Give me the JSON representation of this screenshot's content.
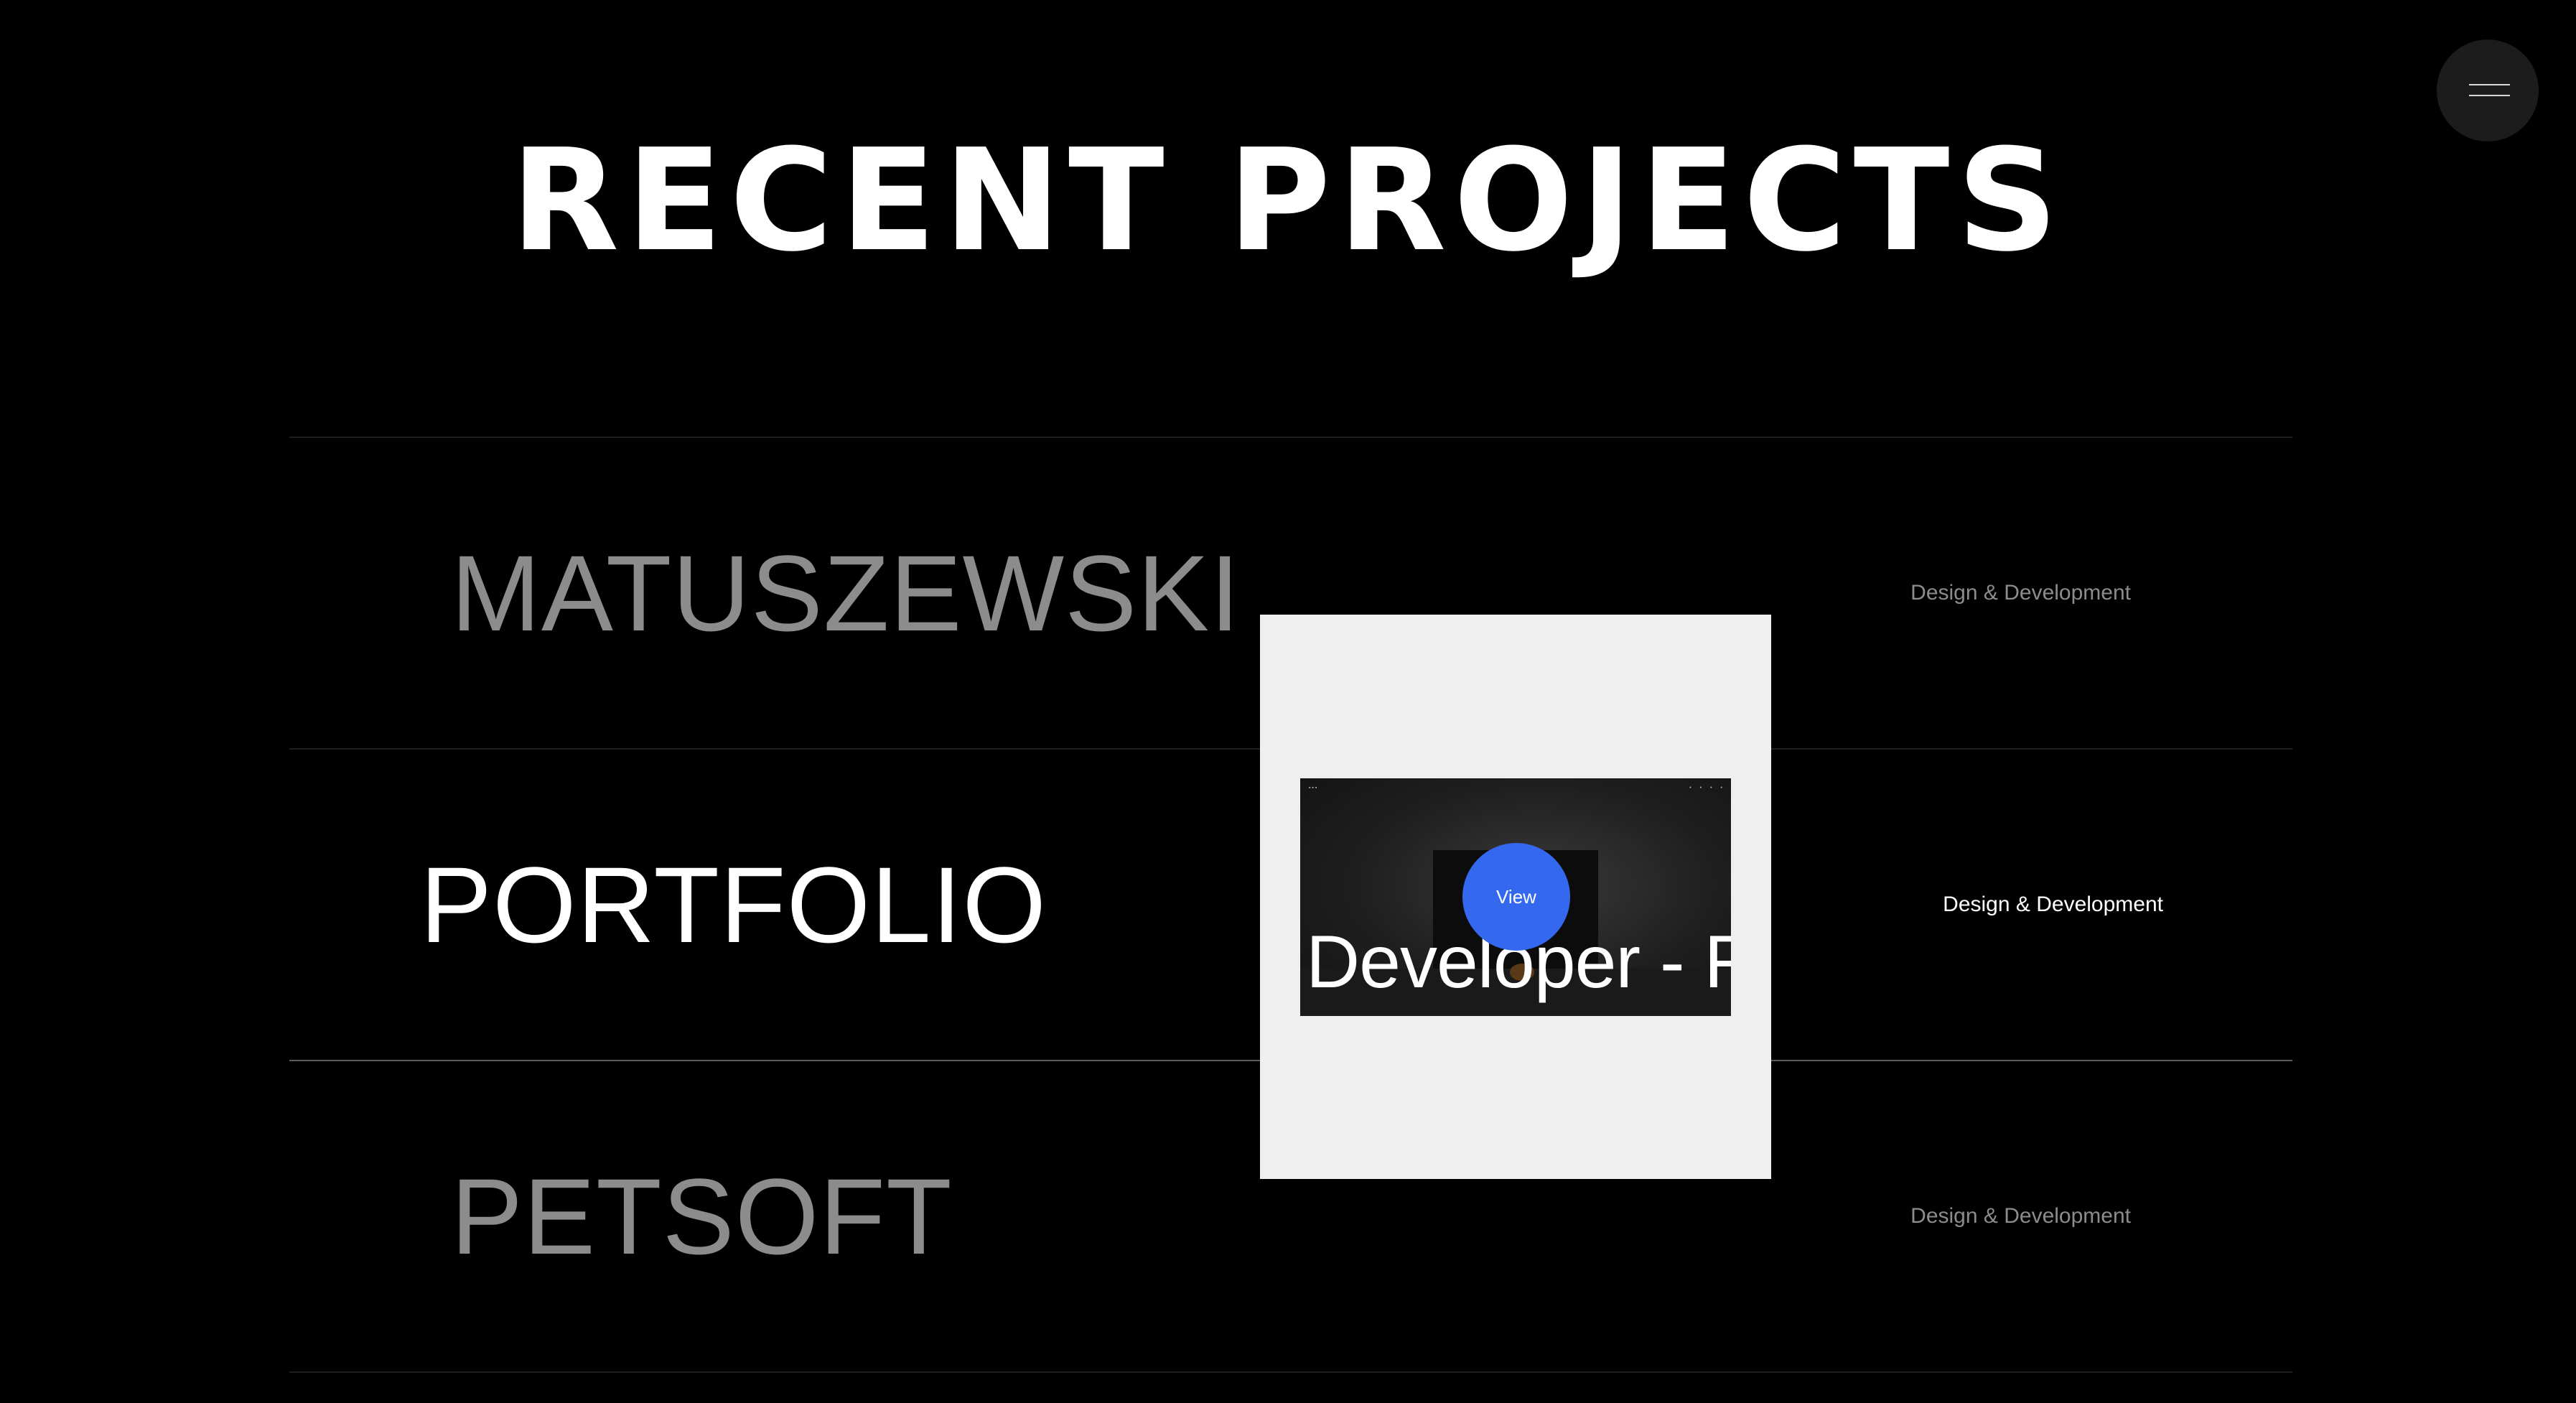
{
  "header": {
    "title": "RECENT PROJECTS",
    "menu_icon": "hamburger-menu-icon"
  },
  "projects": [
    {
      "name": "MATUSZEWSKI",
      "tag": "Design & Development",
      "active": false
    },
    {
      "name": "PORTFOLIO",
      "tag": "Design & Development",
      "active": true
    },
    {
      "name": "PETSOFT",
      "tag": "Design & Development",
      "active": false
    }
  ],
  "preview": {
    "headline": "Developer - F",
    "view_label": "View",
    "accent_color": "#3468ee"
  },
  "colors": {
    "background": "#000000",
    "text_active": "#ffffff",
    "text_muted": "#8c8c8c",
    "card_background": "#efefef"
  }
}
